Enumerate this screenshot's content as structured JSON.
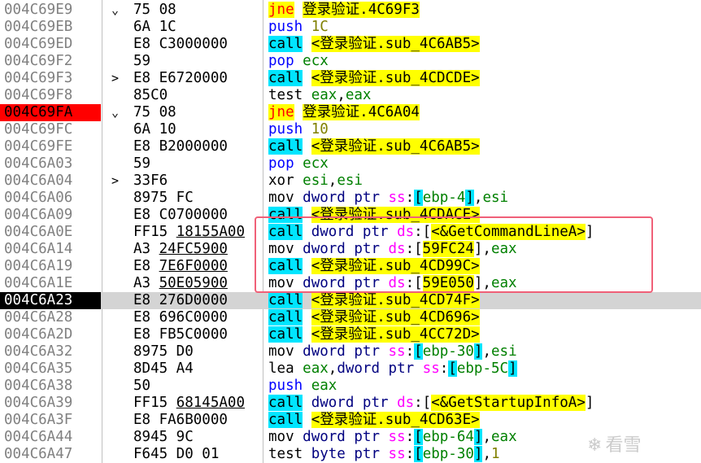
{
  "rows": [
    {
      "addr": "004C69E9",
      "jmp": "⌄",
      "bytes": "75 08",
      "mn": "jne",
      "ops": [
        "lbl:登录验证.4C69F3"
      ]
    },
    {
      "addr": "004C69EB",
      "jmp": "",
      "bytes": "6A 1C",
      "mn": "push",
      "ops": [
        "num:1C"
      ]
    },
    {
      "addr": "004C69ED",
      "jmp": "",
      "bytes": "E8 C3000000",
      "mn": "call",
      "ops": [
        "lbl:<登录验证.sub_4C6AB5>"
      ]
    },
    {
      "addr": "004C69F2",
      "jmp": "",
      "bytes": "59",
      "mn": "pop",
      "ops": [
        "reg:ecx"
      ]
    },
    {
      "addr": "004C69F3",
      "jmp": ">",
      "bytes": "E8 E6720000",
      "mn": "call",
      "ops": [
        "lbl:<登录验证.sub_4CDCDE>"
      ]
    },
    {
      "addr": "004C69F8",
      "jmp": "",
      "bytes": "85C0",
      "mn": "test",
      "ops": [
        "reg:eax",
        "txt:,",
        "reg:eax"
      ]
    },
    {
      "addr": "004C69FA",
      "jmp": "⌄",
      "bytes": "75 08",
      "mn": "jne",
      "ops": [
        "lbl:登录验证.4C6A04"
      ],
      "addr_style": "hl-red"
    },
    {
      "addr": "004C69FC",
      "jmp": "",
      "bytes": "6A 10",
      "mn": "push",
      "ops": [
        "num:10"
      ]
    },
    {
      "addr": "004C69FE",
      "jmp": "",
      "bytes": "E8 B2000000",
      "mn": "call",
      "ops": [
        "lbl:<登录验证.sub_4C6AB5>"
      ]
    },
    {
      "addr": "004C6A03",
      "jmp": "",
      "bytes": "59",
      "mn": "pop",
      "ops": [
        "reg:ecx"
      ]
    },
    {
      "addr": "004C6A04",
      "jmp": ">",
      "bytes": "33F6",
      "mn": "xor",
      "ops": [
        "reg:esi",
        "txt:,",
        "reg:esi"
      ]
    },
    {
      "addr": "004C6A06",
      "jmp": "",
      "bytes": "8975 FC",
      "mn": "mov",
      "ops": [
        "ptr:dword ptr ",
        "seg:ss",
        "txt::",
        "br:[",
        "reg:ebp-4",
        "br:]",
        "txt:,",
        "reg:esi"
      ]
    },
    {
      "addr": "004C6A09",
      "jmp": "",
      "bytes": "E8 C0700000",
      "mn": "call",
      "ops": [
        "lbl:<登录验证.sub_4CDACE>"
      ]
    },
    {
      "addr": "004C6A0E",
      "jmp": "",
      "bytes": "FF15 18155A00",
      "mn": "call",
      "ops": [
        "ptr:dword ptr ",
        "seg:ds",
        "txt::[",
        "lbl:<&GetCommandLineA>",
        "txt:]"
      ],
      "ul": true
    },
    {
      "addr": "004C6A14",
      "jmp": "",
      "bytes": "A3 24FC5900",
      "mn": "mov",
      "ops": [
        "ptr:dword ptr ",
        "seg:ds",
        "txt::[",
        "lbl:59FC24",
        "txt:],",
        "reg:eax"
      ],
      "ul": true
    },
    {
      "addr": "004C6A19",
      "jmp": "",
      "bytes": "E8 7E6F0000",
      "mn": "call",
      "ops": [
        "lbl:<登录验证.sub_4CD99C>"
      ],
      "ul": true
    },
    {
      "addr": "004C6A1E",
      "jmp": "",
      "bytes": "A3 50E05900",
      "mn": "mov",
      "ops": [
        "ptr:dword ptr ",
        "seg:ds",
        "txt::[",
        "lbl:59E050",
        "txt:],",
        "reg:eax"
      ],
      "ul": true
    },
    {
      "addr": "004C6A23",
      "jmp": "",
      "bytes": "E8 276D0000",
      "mn": "call",
      "ops": [
        "lbl:<登录验证.sub_4CD74F>"
      ],
      "addr_style": "hl-black",
      "sel": true
    },
    {
      "addr": "004C6A28",
      "jmp": "",
      "bytes": "E8 696C0000",
      "mn": "call",
      "ops": [
        "lbl:<登录验证.sub_4CD696>"
      ]
    },
    {
      "addr": "004C6A2D",
      "jmp": "",
      "bytes": "E8 FB5C0000",
      "mn": "call",
      "ops": [
        "lbl:<登录验证.sub_4CC72D>"
      ]
    },
    {
      "addr": "004C6A32",
      "jmp": "",
      "bytes": "8975 D0",
      "mn": "mov",
      "ops": [
        "ptr:dword ptr ",
        "seg:ss",
        "txt::",
        "br:[",
        "reg:ebp-30",
        "br:]",
        "txt:,",
        "reg:esi"
      ]
    },
    {
      "addr": "004C6A35",
      "jmp": "",
      "bytes": "8D45 A4",
      "mn": "lea",
      "ops": [
        "reg:eax",
        "txt:,",
        "ptr:dword ptr ",
        "seg:ss",
        "txt::",
        "br:[",
        "reg:ebp-5C",
        "br:]"
      ]
    },
    {
      "addr": "004C6A38",
      "jmp": "",
      "bytes": "50",
      "mn": "push",
      "ops": [
        "reg:eax"
      ]
    },
    {
      "addr": "004C6A39",
      "jmp": "",
      "bytes": "FF15 68145A00",
      "mn": "call",
      "ops": [
        "ptr:dword ptr ",
        "seg:ds",
        "txt::[",
        "lbl:<&GetStartupInfoA>",
        "txt:]"
      ],
      "ul": true
    },
    {
      "addr": "004C6A3F",
      "jmp": "",
      "bytes": "E8 FA6B0000",
      "mn": "call",
      "ops": [
        "lbl:<登录验证.sub_4CD63E>"
      ]
    },
    {
      "addr": "004C6A44",
      "jmp": "",
      "bytes": "8945 9C",
      "mn": "mov",
      "ops": [
        "ptr:dword ptr ",
        "seg:ss",
        "txt::",
        "br:[",
        "reg:ebp-64",
        "br:]",
        "txt:,",
        "reg:eax"
      ]
    },
    {
      "addr": "004C6A47",
      "jmp": "",
      "bytes": "F645 D0 01",
      "mn": "test",
      "ops": [
        "ptr:byte ptr ",
        "seg:ss",
        "txt::",
        "br:[",
        "reg:ebp-30",
        "br:]",
        "txt:,",
        "num:1"
      ]
    }
  ],
  "watermark": "看雪",
  "colors": {
    "jcc": "#ff0000",
    "call_bg": "#00e5ff",
    "label_bg": "#ffff00",
    "breakpoint": "#ff0000",
    "eip": "#000000"
  }
}
